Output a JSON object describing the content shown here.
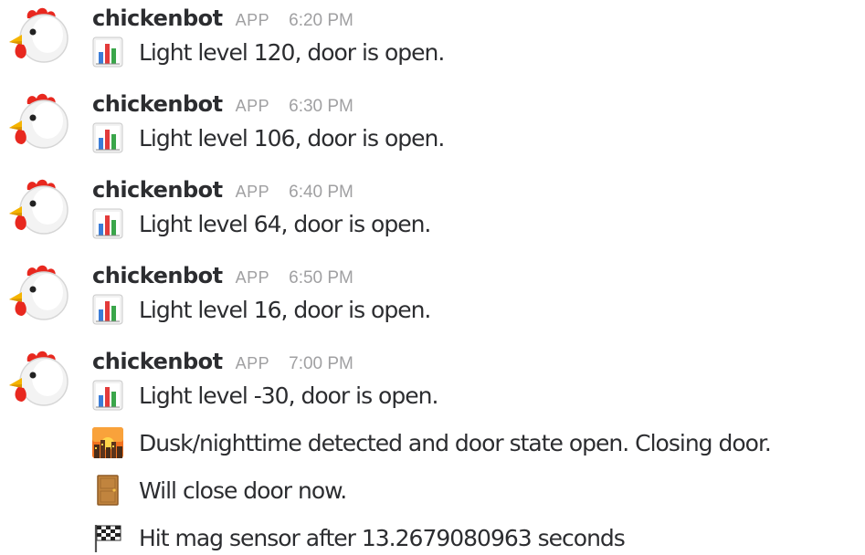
{
  "messages": [
    {
      "username": "chickenbot",
      "badge": "APP",
      "time": "6:20 PM",
      "lines": [
        {
          "icon": "bar-chart-icon",
          "text": "Light level 120, door is open."
        }
      ]
    },
    {
      "username": "chickenbot",
      "badge": "APP",
      "time": "6:30 PM",
      "lines": [
        {
          "icon": "bar-chart-icon",
          "text": "Light level 106, door is open."
        }
      ]
    },
    {
      "username": "chickenbot",
      "badge": "APP",
      "time": "6:40 PM",
      "lines": [
        {
          "icon": "bar-chart-icon",
          "text": "Light level 64, door is open."
        }
      ]
    },
    {
      "username": "chickenbot",
      "badge": "APP",
      "time": "6:50 PM",
      "lines": [
        {
          "icon": "bar-chart-icon",
          "text": "Light level 16, door is open."
        }
      ]
    },
    {
      "username": "chickenbot",
      "badge": "APP",
      "time": "7:00 PM",
      "lines": [
        {
          "icon": "bar-chart-icon",
          "text": "Light level -30, door is open."
        },
        {
          "icon": "city-sunset-icon",
          "text": "Dusk/nighttime detected and door state open. Closing door."
        },
        {
          "icon": "door-icon",
          "text": "Will close door now."
        },
        {
          "icon": "checkered-flag-icon",
          "text": "Hit mag sensor after 13.2679080963 seconds"
        }
      ]
    }
  ],
  "colors": {
    "username": "#2c2d30",
    "meta": "#a0a0a2",
    "text": "#2c2d30"
  }
}
